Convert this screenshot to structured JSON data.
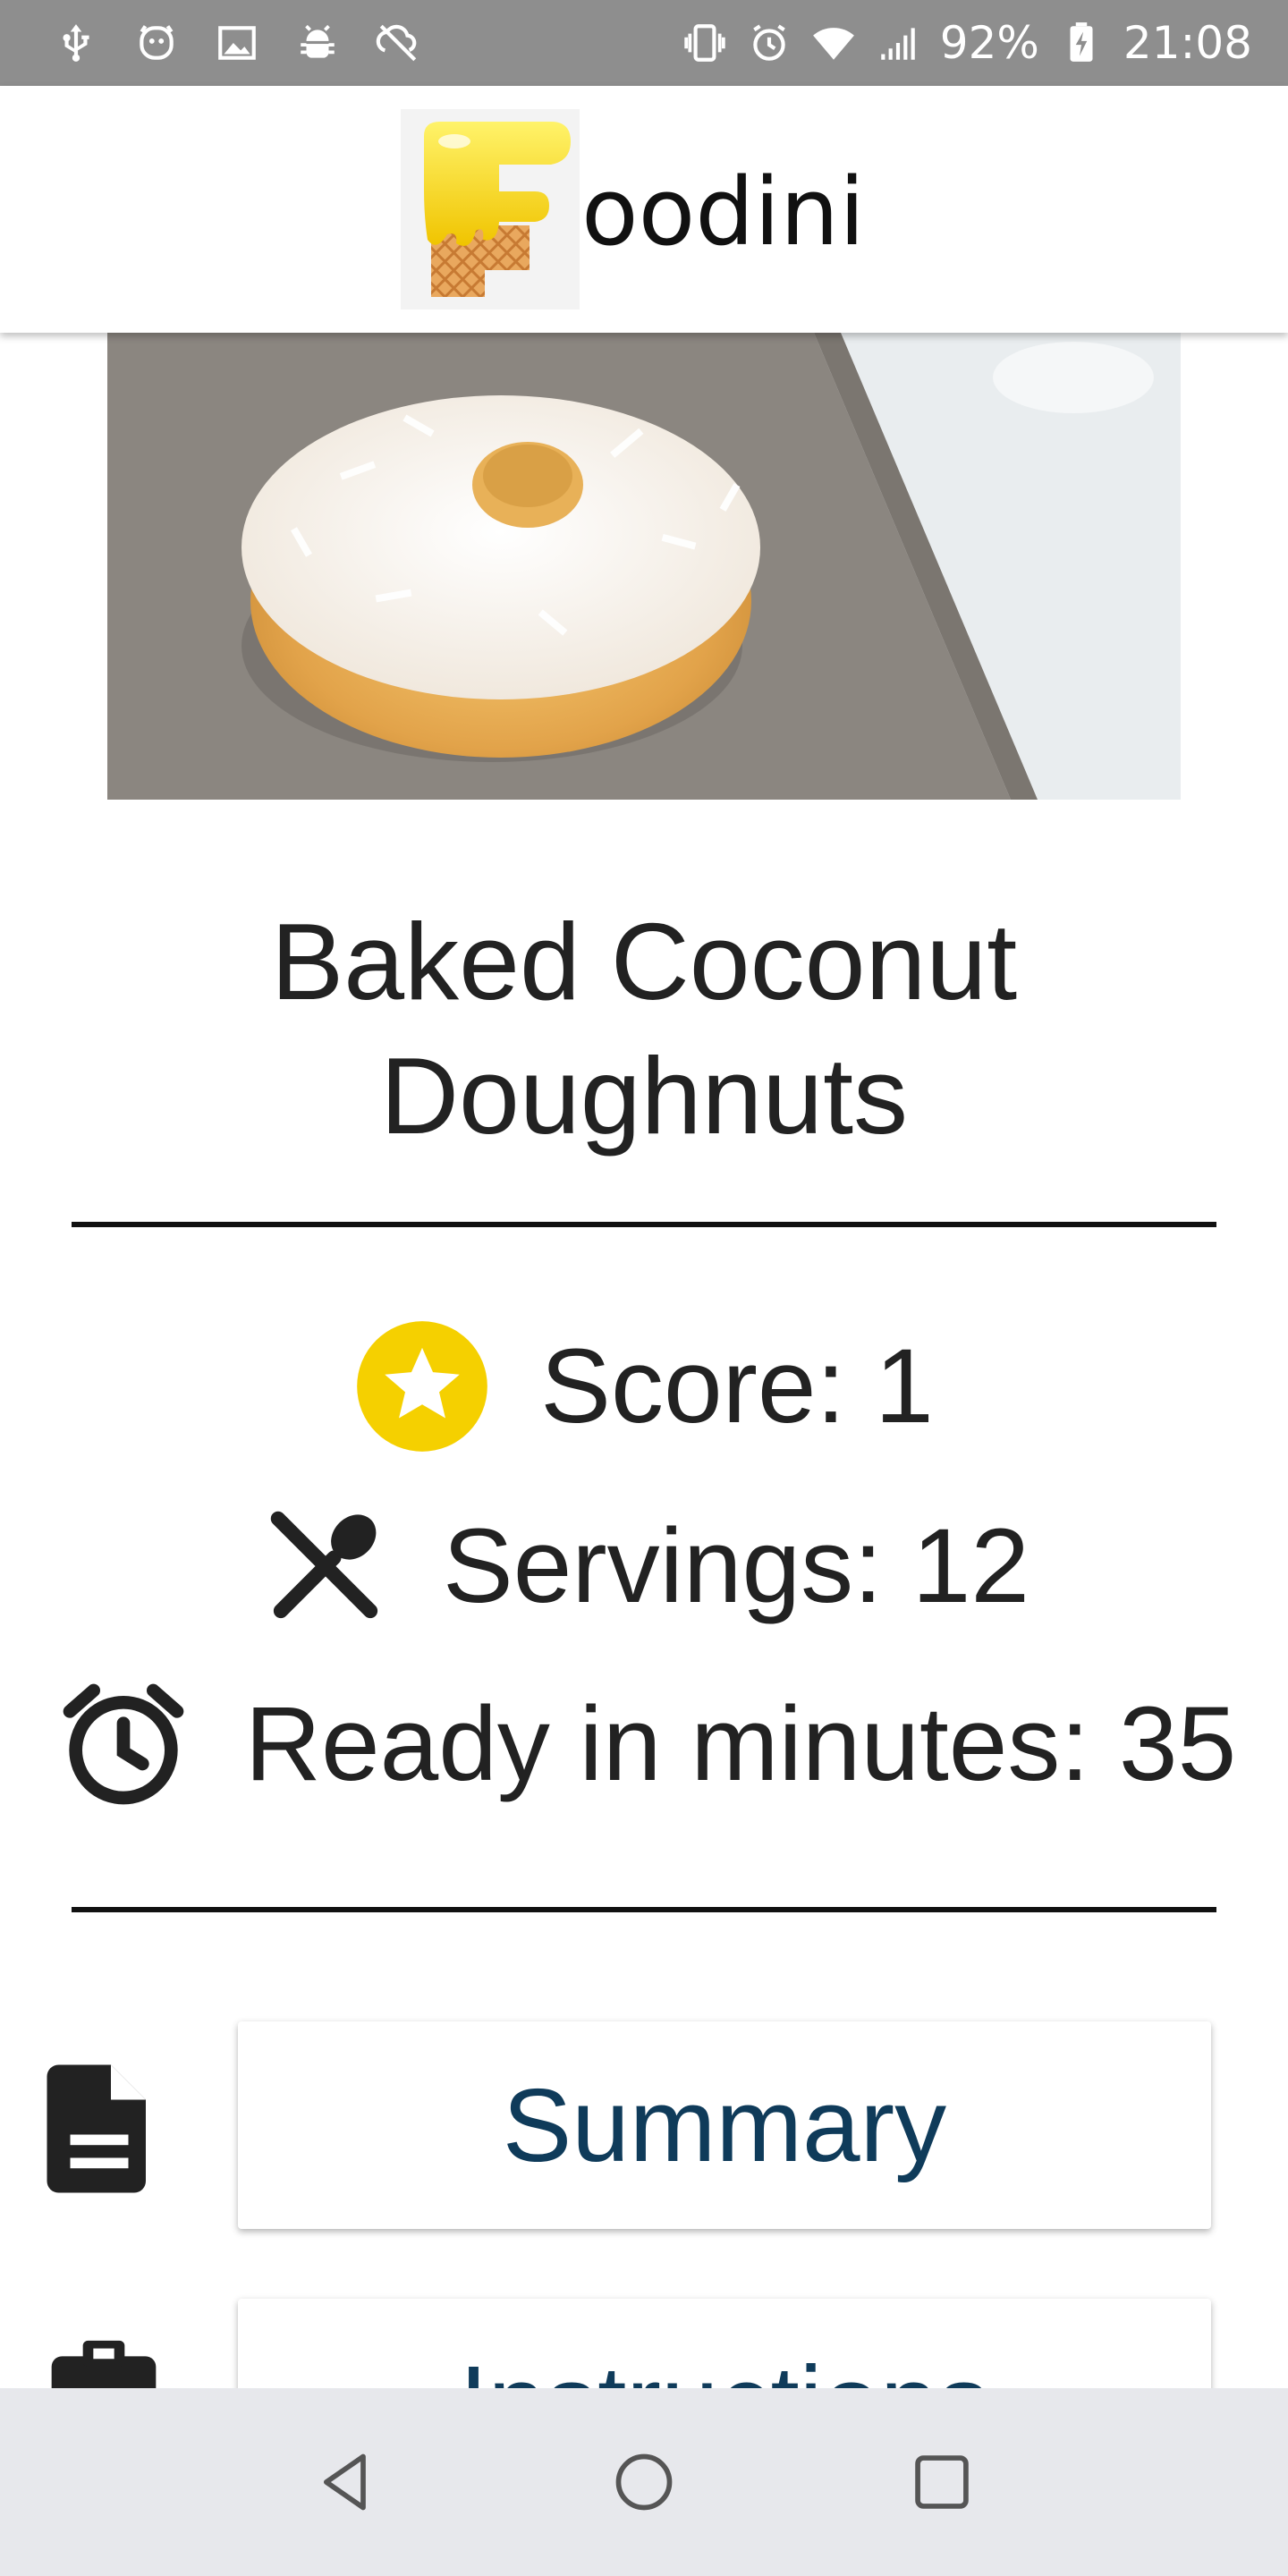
{
  "status_bar": {
    "battery": "92%",
    "time": "21:08",
    "left_icons": [
      "usb-icon",
      "face-icon",
      "image-icon",
      "android-debug-icon",
      "sync-off-icon"
    ],
    "right_icons": [
      "vibrate-icon",
      "alarm-icon",
      "wifi-icon",
      "signal-icon",
      "battery-charging-icon"
    ]
  },
  "app_bar": {
    "logo_icon": "foodini-f-logo",
    "app_name": "oodini"
  },
  "recipe": {
    "title": "Baked Coconut Doughnuts",
    "image_alt": "coconut-doughnut-photo",
    "score": "Score: 1",
    "servings": "Servings: 12",
    "ready": "Ready in minutes: 35"
  },
  "sections": [
    {
      "label": "Summary",
      "icon": "document-icon"
    },
    {
      "label": "Instructions",
      "icon": "clipboard-icon"
    }
  ],
  "colors": {
    "status_bar": "#8e8e8e",
    "star_badge": "#f5d000",
    "button_text": "#0f3b5a",
    "nav_bar": "#e7e8ec"
  },
  "nav_bar": {
    "buttons": [
      "back-icon",
      "home-icon",
      "recents-icon"
    ]
  }
}
